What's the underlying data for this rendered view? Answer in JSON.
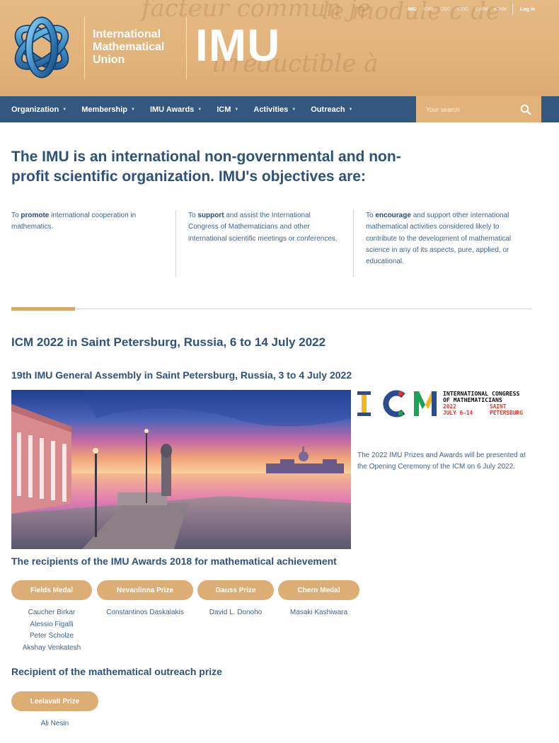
{
  "header": {
    "top_links": [
      {
        "label": "IMU",
        "active": true
      },
      {
        "label": "ICMI",
        "active": false
      },
      {
        "label": "CDC",
        "active": false
      },
      {
        "label": "CEIC",
        "active": false
      },
      {
        "label": "CWM",
        "active": false
      },
      {
        "label": "ICHM",
        "active": false
      }
    ],
    "login_label": "Log in",
    "org_name_lines": [
      "International",
      "Mathematical",
      "Union"
    ],
    "acronym": "IMU",
    "background_script": [
      "facteur commun je",
      "le module c de",
      "irréductible à"
    ]
  },
  "nav": {
    "items": [
      {
        "label": "Organization"
      },
      {
        "label": "Membership"
      },
      {
        "label": "IMU Awards"
      },
      {
        "label": "ICM"
      },
      {
        "label": "Activities"
      },
      {
        "label": "Outreach"
      }
    ],
    "search_placeholder": "Your search"
  },
  "main": {
    "headline": "The IMU is an international non-governmental and non-profit scientific organization. IMU's objectives are:",
    "objectives": [
      {
        "prefix": "To ",
        "keyword": "promote",
        "text": " international cooperation in mathematics."
      },
      {
        "prefix": "To ",
        "keyword": "support",
        "text": " and assist the International Congress of Mathematicians and other international scientific meetings or conferences."
      },
      {
        "prefix": "To ",
        "keyword": "encourage",
        "text": " and support other international mathematical activities considered likely to contribute to the development of mathematical science in any of its aspects, pure, applied, or educational."
      }
    ],
    "icm_title": "ICM 2022 in Saint Petersburg, Russia, 6 to 14 July 2022",
    "ga_title": "19th IMU General Assembly in Saint Petersburg, Russia, 3 to 4 July 2022",
    "icm_logo": {
      "letters": [
        "I",
        "C",
        "M"
      ],
      "line1": "INTERNATIONAL CONGRESS",
      "line2": "OF MATHEMATICIANS",
      "year": "2022",
      "dates": "JULY 6–14",
      "city1": "SAINT",
      "city2": "PETERSBURG"
    },
    "icm_caption": "The 2022 IMU Prizes and Awards will be presented at the Opening Ceremony of the ICM on 6 July 2022.",
    "recipients_title": "The recipients of the IMU Awards 2018 for mathematical achievement",
    "awards": [
      {
        "label": "Fields Medal",
        "winners": [
          "Caucher Birkar",
          "Alessio Figalli",
          "Peter Scholze",
          "Akshay Venkatesh"
        ]
      },
      {
        "label": "Nevanlinna Prize",
        "winners": [
          "Constantinos Daskalakis"
        ]
      },
      {
        "label": "Gauss Prize",
        "winners": [
          "David L. Donoho"
        ]
      },
      {
        "label": "Chern Medal",
        "winners": [
          "Masaki Kashiwara"
        ]
      }
    ],
    "outreach_title": "Recipient of the mathematical outreach prize",
    "outreach_award": {
      "label": "Leelavati Prize",
      "winners": [
        "Ali Nesin"
      ]
    }
  },
  "colors": {
    "header_bg": "#e2b37c",
    "nav_bg": "#33577f",
    "title_blue": "#2f527c",
    "accent_gold": "#d6a86d",
    "icm_yellow": "#f3b71b",
    "icm_blue": "#2a4b8d",
    "icm_green": "#1aa352",
    "icm_red": "#e5352b"
  }
}
